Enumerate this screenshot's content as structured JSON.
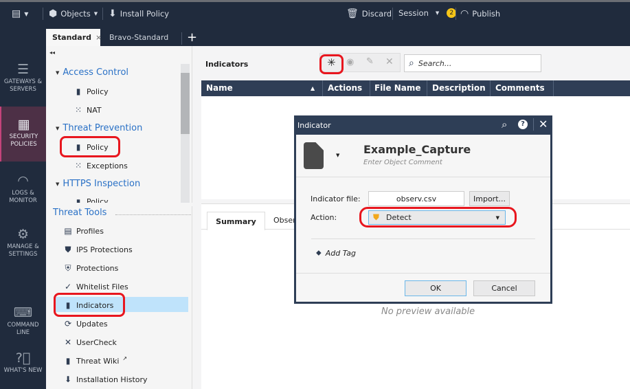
{
  "toolbar": {
    "objects": "Objects",
    "install_policy": "Install Policy",
    "discard": "Discard",
    "session": "Session",
    "session_count": "2",
    "publish": "Publish"
  },
  "policy_tabs": [
    {
      "label": "Standard"
    },
    {
      "label": "Bravo-Standard"
    }
  ],
  "left_nav": [
    {
      "label": "GATEWAYS & SERVERS",
      "icon": "server-icon"
    },
    {
      "label": "SECURITY POLICIES",
      "icon": "firewall-icon",
      "selected": true
    },
    {
      "label": "LOGS & MONITOR",
      "icon": "gauge-icon"
    },
    {
      "label": "MANAGE & SETTINGS",
      "icon": "gear-icon"
    },
    {
      "label": "COMMAND LINE",
      "icon": "terminal-icon"
    },
    {
      "label": "WHAT'S NEW",
      "icon": "help-icon"
    }
  ],
  "tree": {
    "access_control": {
      "label": "Access Control",
      "items": [
        "Policy",
        "NAT"
      ]
    },
    "threat_prevention": {
      "label": "Threat Prevention",
      "items": [
        "Policy",
        "Exceptions"
      ]
    },
    "https_inspection": {
      "label": "HTTPS Inspection",
      "items": [
        "Policy"
      ]
    },
    "threat_tools": {
      "label": "Threat Tools",
      "items": [
        "Profiles",
        "IPS Protections",
        "Protections",
        "Whitelist Files",
        "Indicators",
        "Updates",
        "UserCheck",
        "Threat Wiki",
        "Installation History"
      ],
      "selected": "Indicators"
    }
  },
  "main": {
    "title": "Indicators",
    "search_placeholder": "Search...",
    "columns": [
      "Name",
      "Actions",
      "File Name",
      "Description",
      "Comments"
    ],
    "bottom_tabs": [
      "Summary",
      "Obser"
    ],
    "no_preview": "No preview available"
  },
  "dialog": {
    "title": "Indicator",
    "name": "Example_Capture",
    "comment_placeholder": "Enter Object Comment",
    "indicator_file_label": "Indicator file:",
    "indicator_file_value": "observ.csv",
    "import_label": "Import...",
    "action_label": "Action:",
    "action_value": "Detect",
    "add_tag": "Add Tag",
    "ok": "OK",
    "cancel": "Cancel"
  },
  "colors": {
    "highlight": "#e8161e",
    "accent_blue": "#2a71c6",
    "nav_bg": "#202b3d",
    "selected_row": "#bfe3fb"
  }
}
